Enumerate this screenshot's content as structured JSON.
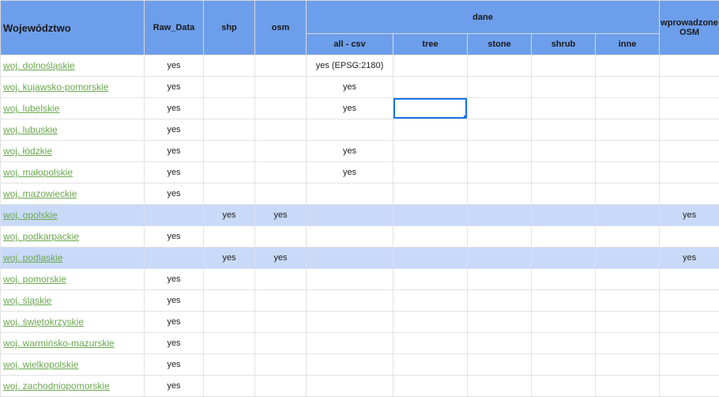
{
  "headers": {
    "wojewodztwo": "Województwo",
    "raw_data": "Raw_Data",
    "shp": "shp",
    "osm": "osm",
    "dane": "dane",
    "all_csv": "all - csv",
    "tree": "tree",
    "stone": "stone",
    "shrub": "shrub",
    "inne": "inne",
    "wprowadzone": "wprowadzone OSM"
  },
  "rows": [
    {
      "name": "woj. dolnośląskie",
      "raw": "yes",
      "shp": "",
      "osm": "",
      "all": "yes (EPSG:2180)",
      "tree": "",
      "stone": "",
      "shrub": "",
      "inne": "",
      "wprow": ""
    },
    {
      "name": "woj. kujawsko-pomorskie",
      "raw": "yes",
      "shp": "",
      "osm": "",
      "all": "yes",
      "tree": "",
      "stone": "",
      "shrub": "",
      "inne": "",
      "wprow": ""
    },
    {
      "name": "woj. lubelskie",
      "raw": "yes",
      "shp": "",
      "osm": "",
      "all": "yes",
      "tree": "",
      "stone": "",
      "shrub": "",
      "inne": "",
      "wprow": ""
    },
    {
      "name": "woj. lubuskie",
      "raw": "yes",
      "shp": "",
      "osm": "",
      "all": "",
      "tree": "",
      "stone": "",
      "shrub": "",
      "inne": "",
      "wprow": ""
    },
    {
      "name": "woj. łódzkie",
      "raw": "yes",
      "shp": "",
      "osm": "",
      "all": "yes",
      "tree": "",
      "stone": "",
      "shrub": "",
      "inne": "",
      "wprow": ""
    },
    {
      "name": "woj. małopolskie",
      "raw": "yes",
      "shp": "",
      "osm": "",
      "all": "yes",
      "tree": "",
      "stone": "",
      "shrub": "",
      "inne": "",
      "wprow": ""
    },
    {
      "name": "woj. mazowieckie",
      "raw": "yes",
      "shp": "",
      "osm": "",
      "all": "",
      "tree": "",
      "stone": "",
      "shrub": "",
      "inne": "",
      "wprow": ""
    },
    {
      "name": "woj. opolskie",
      "raw": "",
      "shp": "yes",
      "osm": "yes",
      "all": "",
      "tree": "",
      "stone": "",
      "shrub": "",
      "inne": "",
      "wprow": "yes"
    },
    {
      "name": "woj. podkarpackie",
      "raw": "yes",
      "shp": "",
      "osm": "",
      "all": "",
      "tree": "",
      "stone": "",
      "shrub": "",
      "inne": "",
      "wprow": ""
    },
    {
      "name": "woj. podlaskie",
      "raw": "",
      "shp": "yes",
      "osm": "yes",
      "all": "",
      "tree": "",
      "stone": "",
      "shrub": "",
      "inne": "",
      "wprow": "yes"
    },
    {
      "name": "woj. pomorskie",
      "raw": "yes",
      "shp": "",
      "osm": "",
      "all": "",
      "tree": "",
      "stone": "",
      "shrub": "",
      "inne": "",
      "wprow": ""
    },
    {
      "name": "woj. śląskie",
      "raw": "yes",
      "shp": "",
      "osm": "",
      "all": "",
      "tree": "",
      "stone": "",
      "shrub": "",
      "inne": "",
      "wprow": ""
    },
    {
      "name": "woj. świętokrzyskie",
      "raw": "yes",
      "shp": "",
      "osm": "",
      "all": "",
      "tree": "",
      "stone": "",
      "shrub": "",
      "inne": "",
      "wprow": ""
    },
    {
      "name": "woj. warmińsko-mazurskie",
      "raw": "yes",
      "shp": "",
      "osm": "",
      "all": "",
      "tree": "",
      "stone": "",
      "shrub": "",
      "inne": "",
      "wprow": ""
    },
    {
      "name": "woj. wielkopolskie",
      "raw": "yes",
      "shp": "",
      "osm": "",
      "all": "",
      "tree": "",
      "stone": "",
      "shrub": "",
      "inne": "",
      "wprow": ""
    },
    {
      "name": "woj. zachodniopomorskie",
      "raw": "yes",
      "shp": "",
      "osm": "",
      "all": "",
      "tree": "",
      "stone": "",
      "shrub": "",
      "inne": "",
      "wprow": ""
    }
  ],
  "highlight_color": "#c9daf8",
  "header_color": "#6d9eeb",
  "link_color": "#6aa84f"
}
